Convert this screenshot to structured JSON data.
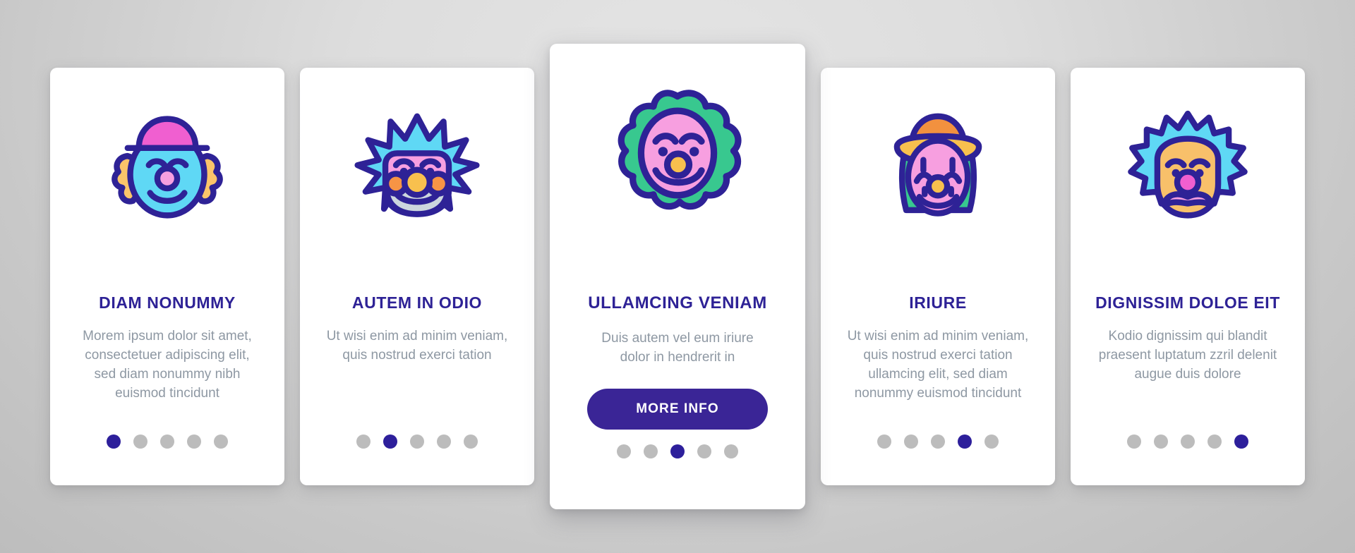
{
  "theme": {
    "accent": "#2e2296",
    "button_bg": "#3a2596",
    "body_text": "#8e98a3",
    "dot_inactive": "#bcbcbc",
    "dot_active": "#2d1f9b",
    "card_bg": "#ffffff",
    "page_bg": "#c8c8c8"
  },
  "screens": [
    {
      "icon": "clown-bowler-hat-icon",
      "title": "DIAM NONUMMY",
      "description": "Morem ipsum dolor sit amet, consectetuer adipiscing elit, sed diam nonummy nibh euismod tincidunt",
      "button": null,
      "dots": {
        "count": 5,
        "active": 1
      },
      "featured": false
    },
    {
      "icon": "clown-spiky-hair-icon",
      "title": "AUTEM IN ODIO",
      "description": "Ut wisi enim ad minim veniam, quis nostrud exerci tation",
      "button": null,
      "dots": {
        "count": 5,
        "active": 2
      },
      "featured": false
    },
    {
      "icon": "clown-afro-icon",
      "title": "ULLAMCING VENIAM",
      "description": "Duis autem vel eum iriure dolor in hendrerit in",
      "button": "MORE INFO",
      "dots": {
        "count": 5,
        "active": 3
      },
      "featured": true
    },
    {
      "icon": "clown-sun-hat-icon",
      "title": "IRIURE",
      "description": "Ut wisi enim ad minim veniam, quis nostrud exerci tation ullamcing elit, sed diam nonummy euismod tincidunt",
      "button": null,
      "dots": {
        "count": 5,
        "active": 4
      },
      "featured": false
    },
    {
      "icon": "clown-sad-face-icon",
      "title": "DIGNISSIM DOLOE EIT",
      "description": "Kodio dignissim qui blandit praesent luptatum zzril delenit augue duis dolore",
      "button": null,
      "dots": {
        "count": 5,
        "active": 5
      },
      "featured": false
    }
  ]
}
